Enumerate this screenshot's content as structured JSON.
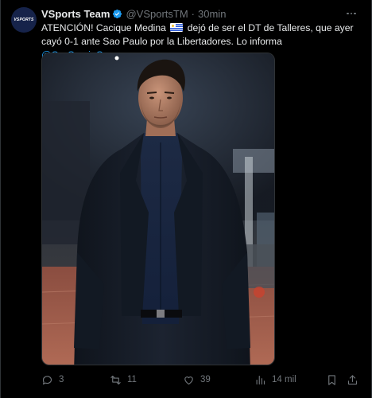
{
  "account": {
    "avatar_text": "VSPORTS",
    "display_name": "VSports Team",
    "handle": "@VSportsTM",
    "separator": "·",
    "time": "30min"
  },
  "tweet": {
    "text_part1": "ATENCIÓN! Cacique Medina",
    "text_part2": "dejó de ser el DT de Talleres, que ayer cayó 0-1 ante Sao Paulo por la Libertadores. Lo informa",
    "mention": "@GerGarciaGrova",
    "text_end": "."
  },
  "media": {
    "subject": "coach-photo"
  },
  "actions": {
    "replies": "3",
    "retweets": "11",
    "likes": "39",
    "views": "14 mil"
  },
  "colors": {
    "background": "#000000",
    "text": "#e7e9ea",
    "secondary": "#71767b",
    "link": "#1d9bf0",
    "border": "#2f3336"
  }
}
